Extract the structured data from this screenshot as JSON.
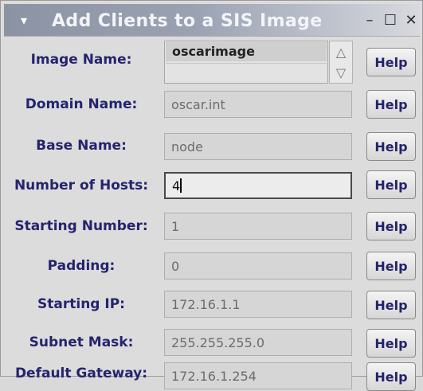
{
  "window": {
    "title": "Add Clients to a SIS Image",
    "menu_icon": "window-menu-icon",
    "buttons": {
      "minimize": "minimize-icon",
      "maximize": "maximize-icon",
      "close": "close-icon"
    }
  },
  "form": {
    "image_name": {
      "label": "Image Name:",
      "value": "oscarimage",
      "help": "Help"
    },
    "domain_name": {
      "label": "Domain Name:",
      "value": "oscar.int",
      "help": "Help"
    },
    "base_name": {
      "label": "Base Name:",
      "value": "node",
      "help": "Help"
    },
    "number_of_hosts": {
      "label": "Number of Hosts:",
      "value": "4",
      "help": "Help"
    },
    "starting_number": {
      "label": "Starting Number:",
      "value": "1",
      "help": "Help"
    },
    "padding": {
      "label": "Padding:",
      "value": "0",
      "help": "Help"
    },
    "starting_ip": {
      "label": "Starting IP:",
      "value": "172.16.1.1",
      "help": "Help"
    },
    "subnet_mask": {
      "label": "Subnet Mask:",
      "value": "255.255.255.0",
      "help": "Help"
    },
    "default_gateway": {
      "label": "Default Gateway:",
      "value": "172.16.1.254",
      "help": "Help"
    }
  }
}
